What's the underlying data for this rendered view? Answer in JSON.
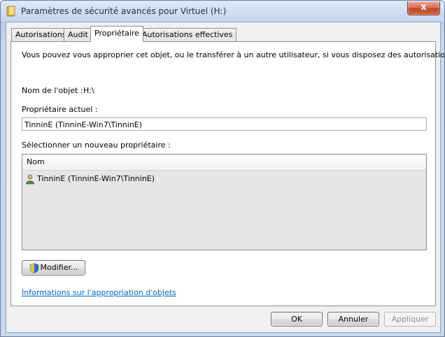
{
  "window": {
    "title": "Paramètres de sécurité avancés pour Virtuel (H:)",
    "close_glyph": "x"
  },
  "tabs": [
    {
      "label": "Autorisations",
      "active": false
    },
    {
      "label": "Audit",
      "active": false
    },
    {
      "label": "Propriétaire",
      "active": true
    },
    {
      "label": "Autorisations effectives",
      "active": false
    }
  ],
  "owner_tab": {
    "description": "Vous pouvez vous approprier cet objet, ou le transférer à un autre utilisateur, si vous disposez des autorisations requises.",
    "object_name_label": "Nom de l'objet :",
    "object_name_value": "H:\\",
    "current_owner_label": "Propriétaire actuel :",
    "current_owner_value": "TinninE (TinninE-Win7\\TinninE)",
    "new_owner_label": "Sélectionner un nouveau propriétaire :",
    "list": {
      "column_header": "Nom",
      "items": [
        "TinninE (TinninE-Win7\\TinninE)"
      ]
    },
    "modify_button": "Modifier...",
    "info_link": "Informations sur l'appropriation d'objets"
  },
  "footer": {
    "ok": "OK",
    "cancel": "Annuler",
    "apply": "Appliquer"
  },
  "icons": {
    "title": "folder-icon",
    "user": "user-icon",
    "uac": "shield-icon"
  }
}
